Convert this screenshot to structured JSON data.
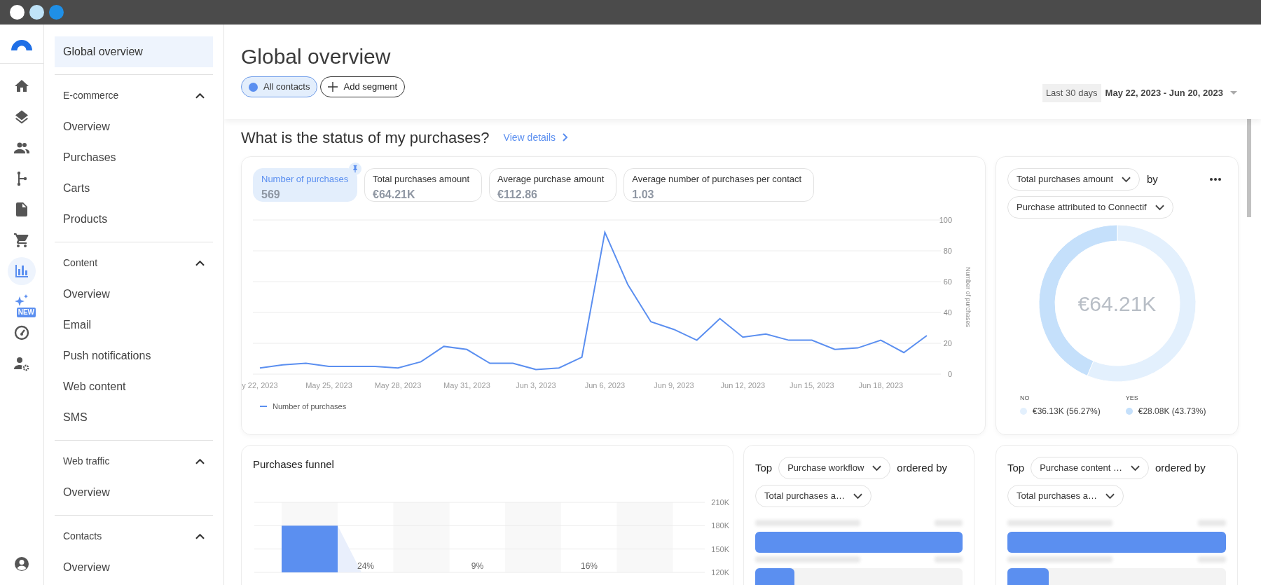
{
  "rail": {
    "items": [
      {
        "kind": "home",
        "selected": false
      },
      {
        "kind": "layers",
        "selected": false
      },
      {
        "kind": "people",
        "selected": false
      },
      {
        "kind": "branch",
        "selected": false
      },
      {
        "kind": "document",
        "selected": false
      },
      {
        "kind": "cart",
        "selected": false
      },
      {
        "kind": "chart",
        "selected": true
      },
      {
        "kind": "sparkle",
        "selected": false,
        "badge": "NEW"
      },
      {
        "kind": "gauge",
        "selected": false
      },
      {
        "kind": "usergear",
        "selected": false
      }
    ]
  },
  "sidebar": {
    "top_item": {
      "label": "Global overview",
      "selected": true
    },
    "groups": [
      {
        "title": "E-commerce",
        "expanded": true,
        "items": [
          {
            "label": "Overview",
            "selected": false
          },
          {
            "label": "Purchases",
            "selected": false
          },
          {
            "label": "Carts",
            "selected": false
          },
          {
            "label": "Products",
            "selected": false
          }
        ]
      },
      {
        "title": "Content",
        "expanded": true,
        "items": [
          {
            "label": "Overview",
            "selected": false
          },
          {
            "label": "Email",
            "selected": false
          },
          {
            "label": "Push notifications",
            "selected": false
          },
          {
            "label": "Web content",
            "selected": false
          },
          {
            "label": "SMS",
            "selected": false
          }
        ]
      },
      {
        "title": "Web traffic",
        "expanded": true,
        "items": [
          {
            "label": "Overview",
            "selected": false
          }
        ]
      },
      {
        "title": "Contacts",
        "expanded": true,
        "items": [
          {
            "label": "Overview",
            "selected": false
          }
        ]
      }
    ]
  },
  "header": {
    "title": "Global overview",
    "segments": [
      {
        "label": "All contacts",
        "selected": true
      }
    ],
    "add_segment": "Add segment",
    "period": "Last 30 days",
    "date_range": "May 22, 2023 - Jun 20, 2023"
  },
  "section": {
    "title": "What is the status of my purchases?",
    "link": "View details"
  },
  "kpis": [
    {
      "label": "Number of purchases",
      "value": "569",
      "selected": true,
      "pinned": true
    },
    {
      "label": "Total purchases amount",
      "value": "€64.21K",
      "selected": false,
      "pinned": false
    },
    {
      "label": "Average purchase amount",
      "value": "€112.86",
      "selected": false,
      "pinned": false
    },
    {
      "label": "Average number of purchases per contact",
      "value": "1.03",
      "selected": false,
      "pinned": false
    }
  ],
  "line_chart": {
    "chart_data": {
      "type": "line",
      "ylabel": "Number of purchases",
      "ylim": [
        0,
        100
      ],
      "yticks": [
        0,
        20,
        40,
        60,
        80,
        100
      ],
      "grid": true,
      "categories": [
        "y 22, 2023",
        null,
        null,
        "May 25, 2023",
        null,
        null,
        "May 28, 2023",
        null,
        null,
        "May 31, 2023",
        null,
        null,
        "Jun 3, 2023",
        null,
        null,
        "Jun 6, 2023",
        null,
        null,
        "Jun 9, 2023",
        null,
        null,
        "Jun 12, 2023",
        null,
        null,
        "Jun 15, 2023",
        null,
        null,
        "Jun 18, 2023",
        null,
        null
      ],
      "series": [
        {
          "name": "Number of purchases",
          "color": "#5b8ff0",
          "values": [
            4,
            6,
            7,
            5,
            5,
            5,
            4,
            8,
            18,
            16,
            7,
            7,
            3,
            4,
            11,
            92,
            58,
            34,
            29,
            22,
            36,
            24,
            26,
            22,
            22,
            16,
            17,
            22,
            14,
            25
          ]
        }
      ]
    }
  },
  "breakdown": {
    "metric": "Total purchases amount",
    "by": "by",
    "dimension": "Purchase attributed to Connectif",
    "center": "€64.21K",
    "legend": [
      {
        "value": "€36.13K (56.27%)",
        "color": "#e3f0fd"
      },
      {
        "value": "€28.08K (43.73%)",
        "color": "#c5e0fb"
      }
    ],
    "chart_data": {
      "type": "donut",
      "categories": [
        "NO",
        "YES"
      ],
      "values": [
        56.27,
        43.73
      ]
    }
  },
  "funnel": {
    "title": "Purchases funnel",
    "chart_data": {
      "type": "bar",
      "values": [
        180000,
        null,
        null,
        null
      ],
      "grid": true,
      "ylim": [
        120000,
        210000
      ],
      "yticks": [
        {
          "value": 120000,
          "label": "120K"
        },
        {
          "value": 150000,
          "label": "150K"
        },
        {
          "value": 180000,
          "label": "180K"
        },
        {
          "value": 210000,
          "label": "210K"
        }
      ],
      "annotations": [
        "24%",
        "9%",
        "16%"
      ]
    }
  },
  "tops": [
    {
      "top": "Top",
      "dimension": "Purchase workflow",
      "ordered_by": "ordered by",
      "metric": "Total purchases a…",
      "bars": [
        {
          "level": 1
        },
        {
          "level": 0.19
        }
      ]
    },
    {
      "top": "Top",
      "dimension": "Purchase content …",
      "ordered_by": "ordered by",
      "metric": "Total purchases a…",
      "bars": [
        {
          "level": 1
        },
        {
          "level": 0.19
        }
      ]
    }
  ]
}
